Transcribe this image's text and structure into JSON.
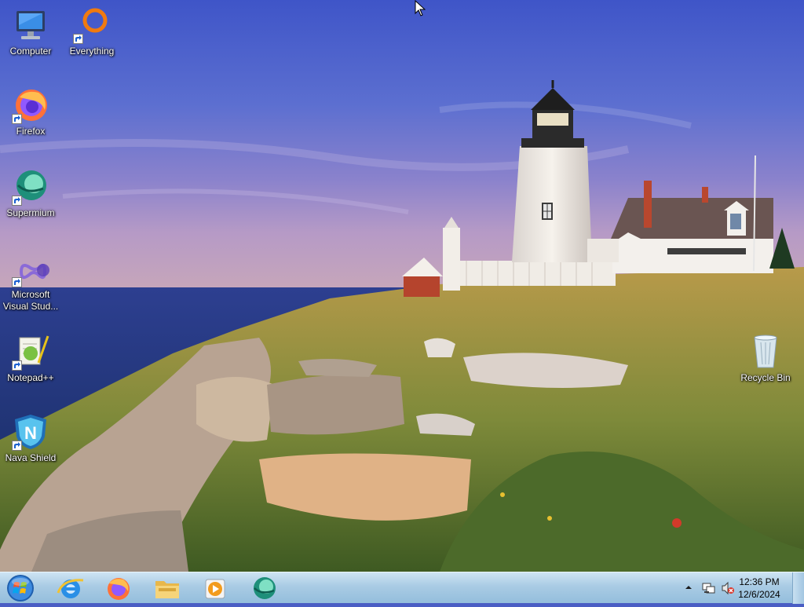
{
  "desktop": {
    "icons": [
      {
        "label": "Computer",
        "icon": "computer-icon"
      },
      {
        "label": "Everything",
        "icon": "everything-icon"
      },
      {
        "label": "Firefox",
        "icon": "firefox-icon"
      },
      {
        "label": "Supermium",
        "icon": "supermium-icon"
      },
      {
        "label": "Microsoft Visual Stud...",
        "icon": "visual-studio-icon"
      },
      {
        "label": "Notepad++",
        "icon": "notepadpp-icon"
      },
      {
        "label": "Nava Shield",
        "icon": "nava-shield-icon"
      },
      {
        "label": "Recycle Bin",
        "icon": "recycle-bin-icon"
      }
    ]
  },
  "taskbar": {
    "pinned": [
      "start-orb-icon",
      "internet-explorer-icon",
      "firefox-icon",
      "file-explorer-icon",
      "media-player-icon",
      "supermium-icon"
    ],
    "clock": {
      "time": "12:36 PM",
      "date": "12/6/2024"
    }
  },
  "colors": {
    "taskbar": "#a9cbe4",
    "sky": "#4a5ec4"
  }
}
